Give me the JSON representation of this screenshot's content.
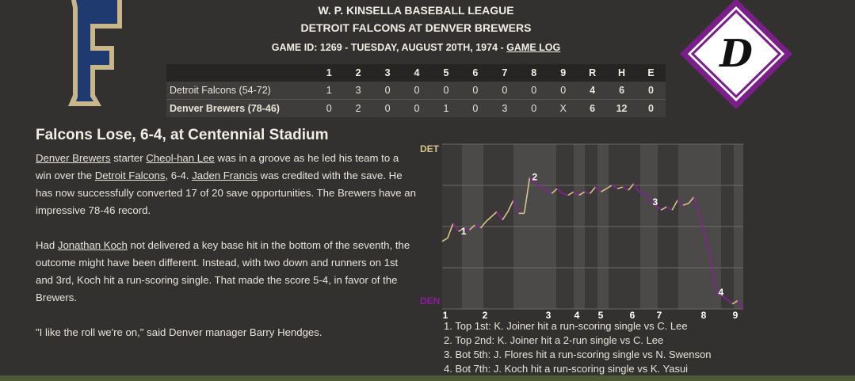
{
  "header": {
    "league": "W. P. KINSELLA BASEBALL LEAGUE",
    "matchup": "DETROIT FALCONS AT DENVER BREWERS",
    "game_id": "GAME ID: 1269 - TUESDAY, AUGUST 20TH, 1974 -",
    "game_log_link": "GAME LOG"
  },
  "logos": {
    "away_letter": "F",
    "home_letter": "D",
    "away_color": "#1e3a6e",
    "away_outline": "#c9b68a",
    "home_color": "#7a1f8a"
  },
  "box_score": {
    "columns": [
      "",
      "1",
      "2",
      "3",
      "4",
      "5",
      "6",
      "7",
      "8",
      "9",
      "R",
      "H",
      "E"
    ],
    "rows": [
      {
        "team": "Detroit Falcons (54-72)",
        "innings": [
          "1",
          "3",
          "0",
          "0",
          "0",
          "0",
          "0",
          "0",
          "0"
        ],
        "R": "4",
        "H": "6",
        "E": "0"
      },
      {
        "team": "Denver Brewers (78-46)",
        "innings": [
          "0",
          "2",
          "0",
          "0",
          "1",
          "0",
          "3",
          "0",
          "X"
        ],
        "R": "6",
        "H": "12",
        "E": "0"
      }
    ]
  },
  "story": {
    "title": "Falcons Lose, 6-4, at Centennial Stadium",
    "p1": {
      "l1": "Denver Brewers",
      "t1": " starter ",
      "l2": "Cheol-han Lee",
      "t2": " was in a groove as he led his team to a win over the ",
      "l3": "Detroit Falcons",
      "t3": ", 6-4. ",
      "l4": "Jaden Francis",
      "t4": " was credited with the save. He has now successfully converted 17 of 20 save opportunities. The Brewers have an impressive 78-46 record."
    },
    "p2": {
      "t0": "Had ",
      "l1": "Jonathan Koch",
      "t1": " not delivered a key base hit in the bottom of the seventh, the outcome might have been different. Instead, with two down and runners on 1st and 3rd, Koch hit a run-scoring single. That made the score 5-4, in favor of the Brewers."
    },
    "p3": "\"I like the roll we're on,\" said Denver manager Barry Hendges."
  },
  "chart_data": {
    "type": "line",
    "title": "",
    "top_label": "DET",
    "bottom_label": "DEN",
    "top_color": "#d8c38a",
    "bottom_color": "#8a1f9a",
    "x_labels": [
      "1",
      "2",
      "3",
      "4",
      "5",
      "6",
      "7",
      "8",
      "9"
    ],
    "ylim": [
      0,
      1
    ],
    "y_meaning": "Detroit win probability",
    "series": [
      {
        "values": [
          0.41,
          0.43,
          0.52,
          0.47,
          0.49,
          0.48,
          0.51,
          0.49,
          0.53,
          0.56,
          0.59,
          0.54,
          0.59,
          0.66,
          0.58,
          0.58,
          0.8,
          0.76,
          0.74,
          0.72,
          0.7,
          0.73,
          0.7,
          0.69,
          0.71,
          0.69,
          0.71,
          0.7,
          0.74,
          0.71,
          0.73,
          0.75,
          0.73,
          0.74,
          0.72,
          0.76,
          0.71,
          0.7,
          0.65,
          0.63,
          0.6,
          0.62,
          0.6,
          0.66,
          0.63,
          0.64,
          0.68,
          0.56,
          0.45,
          0.31,
          0.1,
          0.08,
          0.06,
          0.03,
          0.05,
          0.0
        ]
      }
    ],
    "annotations": [
      {
        "label": "1",
        "idx": 3
      },
      {
        "label": "2",
        "idx": 16
      },
      {
        "label": "3",
        "idx": 38
      },
      {
        "label": "4",
        "idx": 50
      }
    ]
  },
  "scoring_plays": [
    "1. Top 1st: K. Joiner hit a run-scoring single vs C. Lee",
    "2. Top 2nd: K. Joiner hit a 2-run single vs C. Lee",
    "3. Bot 5th: J. Flores hit a run-scoring single vs N. Swenson",
    "4. Bot 7th: J. Koch hit a run-scoring single vs K. Yasui"
  ]
}
